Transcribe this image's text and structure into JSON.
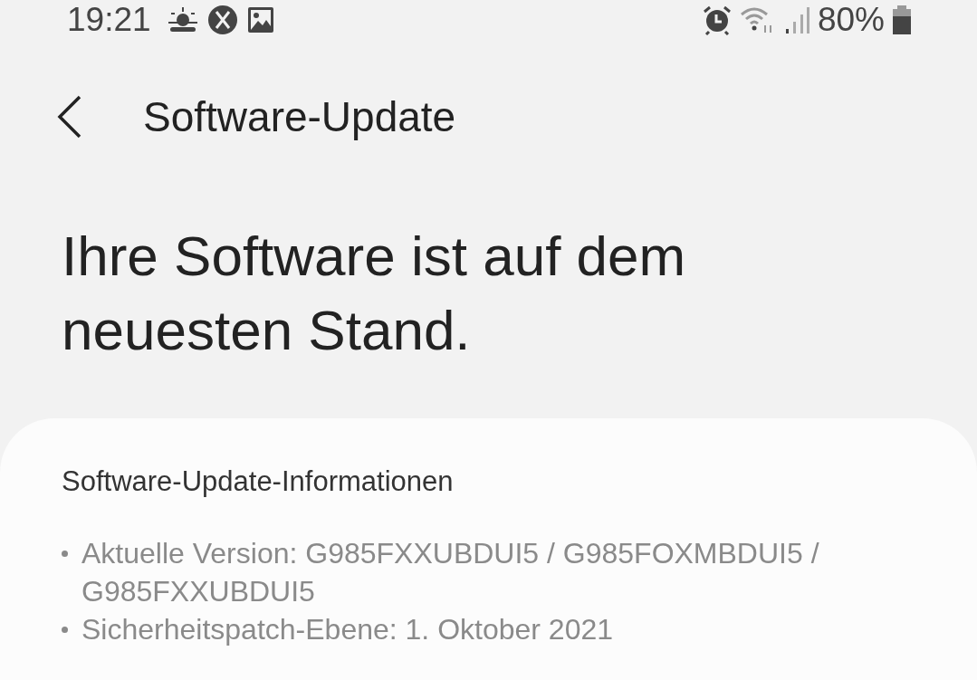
{
  "status_bar": {
    "time": "19:21",
    "battery_text": "80%"
  },
  "header": {
    "title": "Software-Update"
  },
  "headline": "Ihre Software ist auf dem neuesten Stand.",
  "info_card": {
    "title": "Software-Update-Informationen",
    "items": [
      "Aktuelle Version: G985FXXUBDUI5 / G985FOXMBDUI5 / G985FXXUBDUI5",
      "Sicherheitspatch-Ebene: 1. Oktober 2021"
    ]
  }
}
